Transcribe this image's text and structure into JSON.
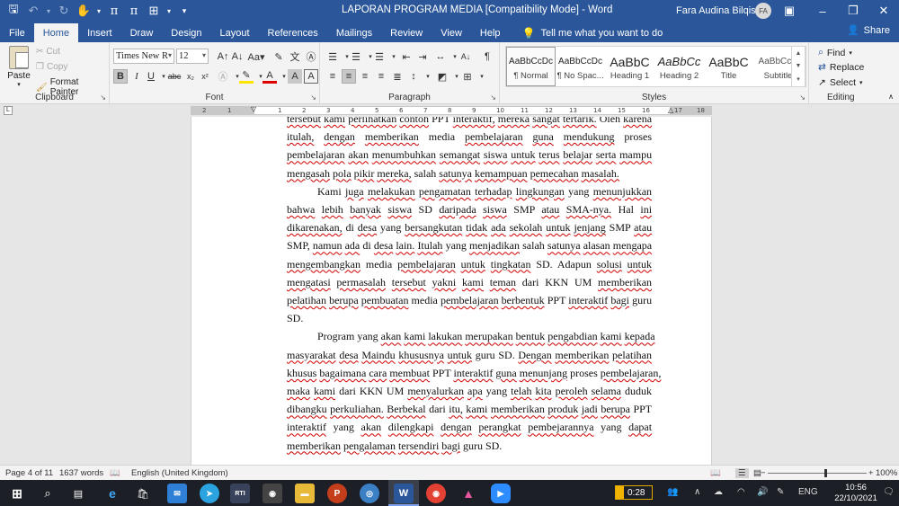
{
  "titlebar": {
    "title": "LAPORAN PROGRAM MEDIA [Compatibility Mode]  -  Word",
    "user_name": "Fara Audina Bilqist Q",
    "user_initials": "FA"
  },
  "tabs": [
    "File",
    "Home",
    "Insert",
    "Draw",
    "Design",
    "Layout",
    "References",
    "Mailings",
    "Review",
    "View",
    "Help"
  ],
  "tell_me": "Tell me what you want to do",
  "share": "Share",
  "clipboard": {
    "paste": "Paste",
    "cut": "Cut",
    "copy": "Copy",
    "format_painter": "Format Painter",
    "label": "Clipboard"
  },
  "font": {
    "name": "Times New R",
    "size": "12",
    "label": "Font"
  },
  "paragraph": {
    "label": "Paragraph"
  },
  "styles": {
    "label": "Styles",
    "items": [
      {
        "sample": "AaBbCcDc",
        "name": "¶ Normal"
      },
      {
        "sample": "AaBbCcDc",
        "name": "¶ No Spac..."
      },
      {
        "sample": "AaBbC",
        "name": "Heading 1"
      },
      {
        "sample": "AaBbCc",
        "name": "Heading 2"
      },
      {
        "sample": "AaBbC",
        "name": "Title"
      },
      {
        "sample": "AaBbCcD",
        "name": "Subtitle"
      }
    ]
  },
  "editing": {
    "find": "Find",
    "replace": "Replace",
    "select": "Select",
    "label": "Editing"
  },
  "ruler_ticks": [
    "2",
    "1",
    "1",
    "2",
    "3",
    "4",
    "5",
    "6",
    "7",
    "8",
    "9",
    "10",
    "11",
    "12",
    "13",
    "14",
    "15",
    "16",
    "17",
    "18"
  ],
  "document": {
    "lines": [
      "tersebut kami perlihatkan contoh PPT interaktif, mereka sangat tertarik. Oleh karena",
      "itulah, dengan memberikan media pembelajaran guna mendukung proses",
      "pembelajaran akan menumbuhkan semangat siswa untuk terus belajar serta mampu",
      "mengasah pola pikir mereka, salah satunya kemampuan pemecahan masalah.",
      "Kami juga melakukan pengamatan terhadap lingkungan yang menunjukkan",
      "bahwa lebih banyak siswa SD daripada siswa SMP atau SMA-nya. Hal ini",
      "dikarenakan, di desa yang bersangkutan tidak ada sekolah untuk jenjang SMP atau",
      "SMP, namun ada di desa lain. Itulah yang menjadikan salah satunya alasan mengapa",
      "mengembangkan media pembelajaran untuk tingkatan SD. Adapun solusi untuk",
      "mengatasi permasalah tersebut yakni kami teman dari KKN UM memberikan",
      "pelatihan berupa pembuatan media pembelajaran berbentuk PPT interaktif bagi guru",
      "SD.",
      "Program yang akan kami lakukan merupakan bentuk pengabdian kami kepada",
      "masyarakat desa Maindu khususnya untuk guru SD. Dengan memberikan pelatihan",
      "khusus bagaimana cara membuat PPT interaktif guna menunjang proses pembelajaran,",
      "maka kami dari KKN UM menyalurkan apa yang telah kita peroleh selama duduk",
      "dibangku perkuliahan. Berbekal dari itu, kami memberikan produk jadi berupa PPT",
      "interaktif yang akan dilengkapi dengan perangkat pembejarannya yang dapat",
      "memberikan pengalaman tersendiri bagi guru SD."
    ]
  },
  "statusbar": {
    "page": "Page 4 of 11",
    "words": "1637 words",
    "language": "English (United Kingdom)",
    "zoom": "100%"
  },
  "taskbar": {
    "battery": "0:28",
    "lang": "ENG",
    "time": "10:56",
    "date": "22/10/2021"
  },
  "colors": {
    "word_blue": "#2b579a",
    "spell_error": "#d00000",
    "grammar": "#3a62c4"
  }
}
